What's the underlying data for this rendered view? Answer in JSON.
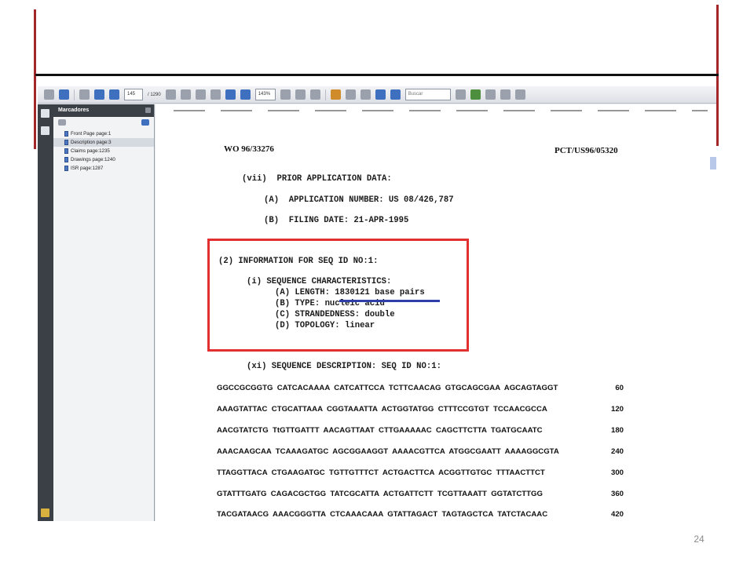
{
  "slide": {
    "page_number": "24"
  },
  "toolbar": {
    "page_current": "145",
    "page_total": "/ 1290",
    "zoom": "143%",
    "search_placeholder": "Buscar"
  },
  "sidebar": {
    "title": "Marcadores",
    "bookmarks": [
      {
        "label": "Front Page page:1"
      },
      {
        "label": "Description page:3"
      },
      {
        "label": "Claims page:1235"
      },
      {
        "label": "Drawings page:1240"
      },
      {
        "label": "ISR page:1287"
      }
    ]
  },
  "document": {
    "header_left": "WO 96/33276",
    "header_right": "PCT/US96/05320",
    "lines": [
      "(vii)  PRIOR APPLICATION DATA:",
      "(A)  APPLICATION NUMBER: US 08/426,787",
      "(B)  FILING DATE: 21-APR-1995",
      "(2) INFORMATION FOR SEQ ID NO:1:",
      "(i) SEQUENCE CHARACTERISTICS:",
      "(A) LENGTH: 1830121 base pairs",
      "(B) TYPE: nucleic acid",
      "(C) STRANDEDNESS: double",
      "(D) TOPOLOGY: linear",
      "(xi) SEQUENCE DESCRIPTION: SEQ ID NO:1:"
    ],
    "sequences": [
      {
        "seq": "GGCCGCGGTG  CATCACAAAA  CATCATTCCA  TCTTCAACAG  GTGCAGCGAA  AGCAGTAGGT",
        "pos": "60"
      },
      {
        "seq": "AAAGTATTAC  CTGCATTAAA  CGGTAAATTA  ACTGGTATGG  CTTTCCGTGT  TCCAACGCCA",
        "pos": "120"
      },
      {
        "seq": "AACGTATCTG  TtGTTGATTT  AACAGTTAAT  CTTGAAAAAC  CAGCTTCTTA  TGATGCAATC",
        "pos": "180"
      },
      {
        "seq": "AAACAAGCAA  TCAAAGATGC  AGCGGAAGGT  AAAACGTTCA  ATGGCGAATT  AAAAGGCGTA",
        "pos": "240"
      },
      {
        "seq": "TTAGGTTACA  CTGAAGATGC  TGTTGTTTCT  ACTGACTTCA  ACGGTTGTGC  TTTAACTTCT",
        "pos": "300"
      },
      {
        "seq": "GTATTTGATG  CAGACGCTGG  TATCGCATTA  ACTGATTCTT  TCGTTAAATT  GGTATCTTGG",
        "pos": "360"
      },
      {
        "seq": "TACGATAACG  AAACGGGTTA  CTCAAACAAA  GTATTAGACT  TAGTAGCTCA  TATCTACAAC",
        "pos": "420"
      }
    ]
  },
  "colors": {
    "slide_accent": "#a3262a",
    "highlight_box": "#e03030",
    "underline": "#2e3fa8"
  }
}
